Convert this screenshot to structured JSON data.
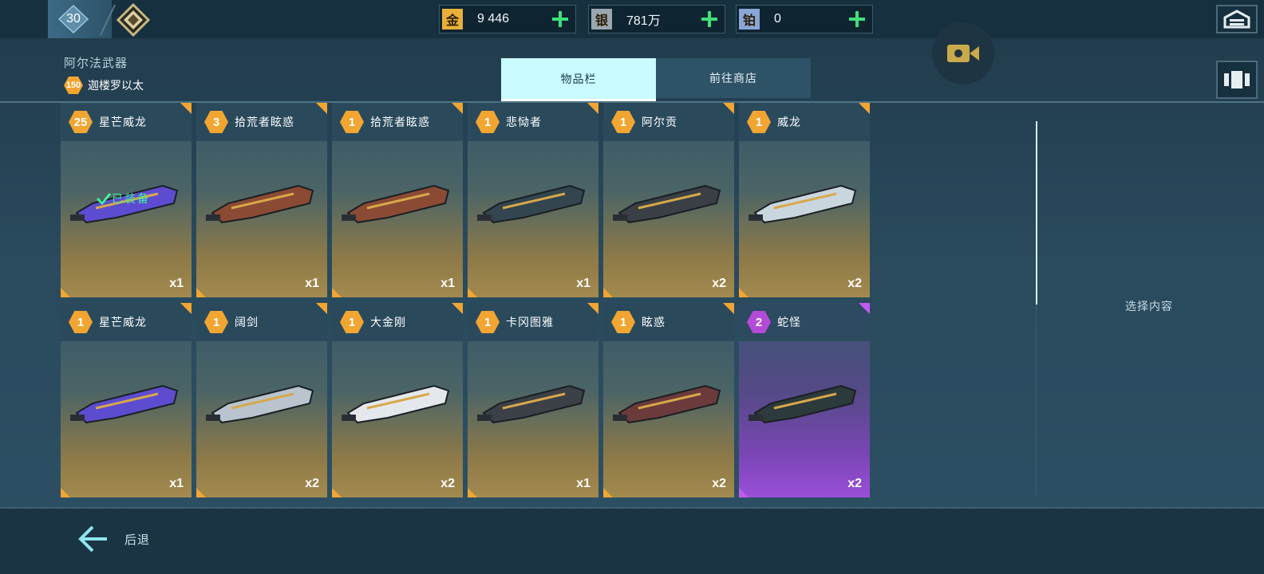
{
  "player": {
    "level": "30"
  },
  "currencies": [
    {
      "icon": "金",
      "name": "gold",
      "value": "9 446",
      "color": "#e8b03a"
    },
    {
      "icon": "银",
      "name": "silver",
      "value": "781万",
      "color": "#9aa7ae"
    },
    {
      "icon": "铂",
      "name": "platinum",
      "value": "0",
      "color": "#8aa6d6"
    }
  ],
  "header": {
    "category_title": "阿尔法武器",
    "coin_badge": "150",
    "coin_text": "迦楼罗以太"
  },
  "tabs": [
    {
      "label": "物品栏",
      "active": true
    },
    {
      "label": "前往商店",
      "active": false
    }
  ],
  "cards": [
    {
      "count": "25",
      "name": "星芒威龙",
      "qty": "x1",
      "rarity": "gold",
      "equipped": true,
      "equipped_label": "已装备",
      "weapon_color": "#5d4ccf"
    },
    {
      "count": "3",
      "name": "拾荒者眩惑",
      "qty": "x1",
      "rarity": "gold",
      "equipped": false,
      "weapon_color": "#8a4a34"
    },
    {
      "count": "1",
      "name": "拾荒者眩惑",
      "qty": "x1",
      "rarity": "gold",
      "equipped": false,
      "weapon_color": "#8a4a34"
    },
    {
      "count": "1",
      "name": "悲恸者",
      "qty": "x1",
      "rarity": "gold",
      "equipped": false,
      "weapon_color": "#33454f"
    },
    {
      "count": "1",
      "name": "阿尔贡",
      "qty": "x2",
      "rarity": "gold",
      "equipped": false,
      "weapon_color": "#3a3f46"
    },
    {
      "count": "1",
      "name": "威龙",
      "qty": "x2",
      "rarity": "gold",
      "equipped": false,
      "weapon_color": "#c9d6de"
    },
    {
      "count": "1",
      "name": "星芒威龙",
      "qty": "x1",
      "rarity": "gold",
      "equipped": false,
      "weapon_color": "#5d4ccf"
    },
    {
      "count": "1",
      "name": "阔剑",
      "qty": "x2",
      "rarity": "gold",
      "equipped": false,
      "weapon_color": "#b9c4ce"
    },
    {
      "count": "1",
      "name": "大金刚",
      "qty": "x2",
      "rarity": "gold",
      "equipped": false,
      "weapon_color": "#e4e8ec"
    },
    {
      "count": "1",
      "name": "卡冈图雅",
      "qty": "x1",
      "rarity": "gold",
      "equipped": false,
      "weapon_color": "#3c4148"
    },
    {
      "count": "1",
      "name": "眩惑",
      "qty": "x2",
      "rarity": "gold",
      "equipped": false,
      "weapon_color": "#6b3a3a"
    },
    {
      "count": "2",
      "name": "蛇怪",
      "qty": "x2",
      "rarity": "purple",
      "equipped": false,
      "weapon_color": "#2d3a3c"
    }
  ],
  "side_panel": {
    "hint": "选择内容"
  },
  "footer": {
    "back_label": "后退"
  }
}
